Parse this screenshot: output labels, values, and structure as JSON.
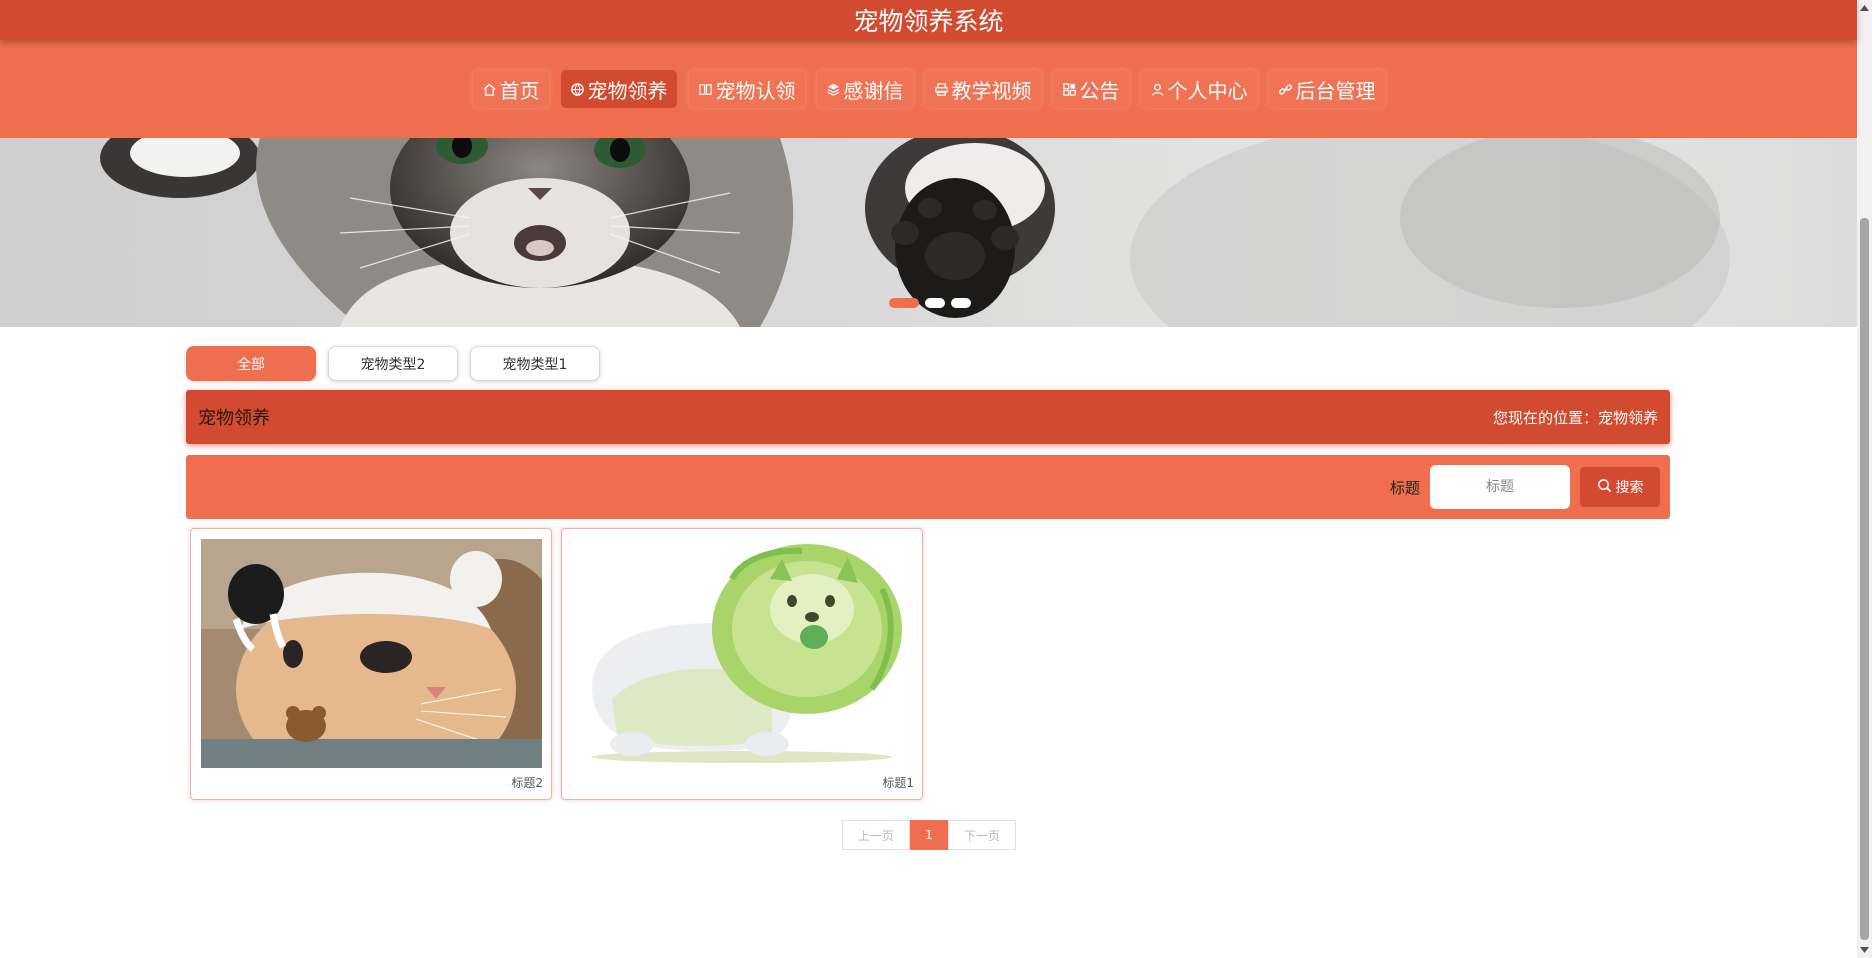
{
  "header": {
    "title": "宠物领养系统"
  },
  "nav": {
    "items": [
      {
        "label": "首页",
        "icon": "home-icon"
      },
      {
        "label": "宠物领养",
        "icon": "globe-icon",
        "active": true
      },
      {
        "label": "宠物认领",
        "icon": "columns-icon"
      },
      {
        "label": "感谢信",
        "icon": "layers-icon"
      },
      {
        "label": "教学视频",
        "icon": "print-icon"
      },
      {
        "label": "公告",
        "icon": "grid-icon"
      },
      {
        "label": "个人中心",
        "icon": "user-icon"
      },
      {
        "label": "后台管理",
        "icon": "link-icon"
      }
    ]
  },
  "banner": {
    "slide_count": 3,
    "active_slide": 1
  },
  "categories": [
    {
      "label": "全部",
      "active": true
    },
    {
      "label": "宠物类型2"
    },
    {
      "label": "宠物类型1"
    }
  ],
  "section": {
    "title": "宠物领养",
    "location_prefix": "您现在的位置：",
    "location": "宠物领养"
  },
  "search": {
    "label": "标题",
    "placeholder": "标题",
    "button_label": "搜索"
  },
  "cards": [
    {
      "caption": "标题2"
    },
    {
      "caption": "标题1"
    }
  ],
  "pagination": {
    "prev_label": "上一页",
    "current_page": "1",
    "next_label": "下一页"
  },
  "colors": {
    "primary_dark": "#d24a30",
    "primary": "#ef6e4e",
    "card_border": "#f0b1a2"
  }
}
